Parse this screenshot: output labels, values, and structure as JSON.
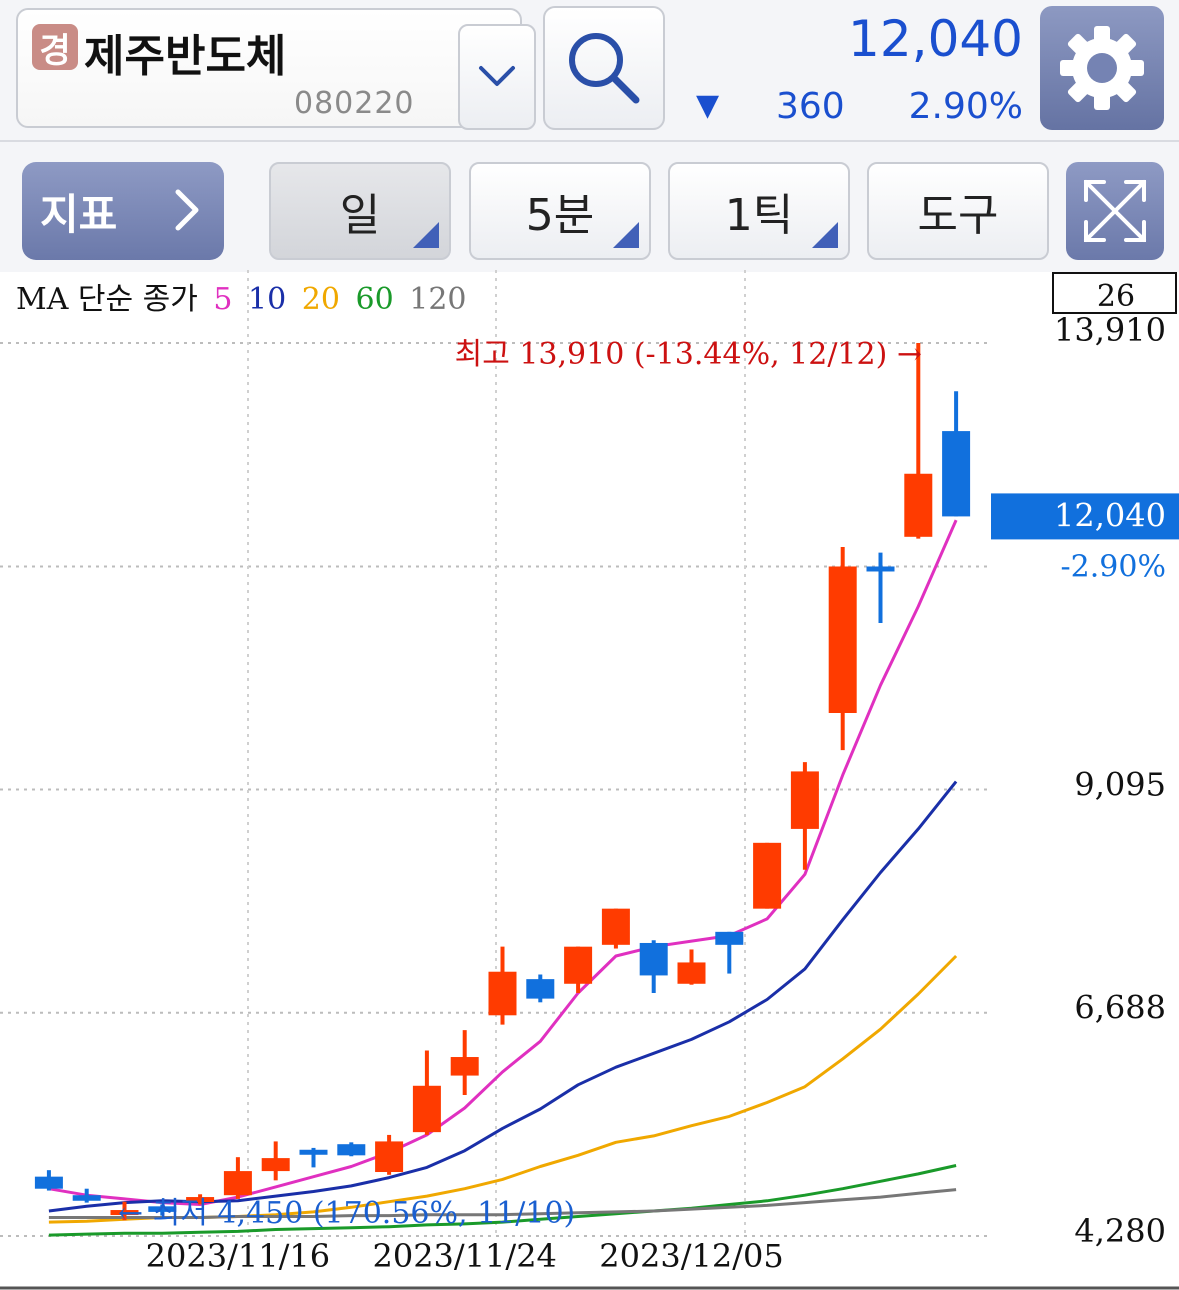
{
  "header": {
    "market_badge": "경",
    "stock_name": "제주반도체",
    "stock_code": "080220",
    "price": "12,040",
    "change_arrow": "▼",
    "change_value": "360",
    "change_pct": "2.90%",
    "price_color": "#1a4fcf"
  },
  "toolbar": {
    "indicator_label": "지표",
    "tabs": [
      {
        "label": "일",
        "active": true
      },
      {
        "label": "5분",
        "active": false
      },
      {
        "label": "1틱",
        "active": false
      }
    ],
    "tool_label": "도구"
  },
  "legend": {
    "title": "MA 단순 종가",
    "periods": [
      {
        "label": "5",
        "color": "#e030c0"
      },
      {
        "label": "10",
        "color": "#1a2fa8"
      },
      {
        "label": "20",
        "color": "#f0a800"
      },
      {
        "label": "60",
        "color": "#1a9a2a"
      },
      {
        "label": "120",
        "color": "#777777"
      }
    ]
  },
  "chart_data": {
    "type": "candlestick",
    "ylim": [
      4280,
      13910
    ],
    "y_ticks": [
      "13,910",
      "9,095",
      "6,688",
      "4,280"
    ],
    "y_tick_values": [
      13910,
      9095,
      6688,
      4280
    ],
    "x_tick_labels": [
      {
        "label": "2023/11/16",
        "index": 5
      },
      {
        "label": "2023/11/24",
        "index": 11
      },
      {
        "label": "2023/12/05",
        "index": 17
      }
    ],
    "count_box": "26",
    "current_price_label": "12,040",
    "current_pct_label": "-2.90%",
    "high_annotation": "최고 13,910 (-13.44%, 12/12) →",
    "low_annotation": "← 최저 4,450 (170.56%, 11/10)",
    "up_color": "#ff3b00",
    "down_color": "#1170dd",
    "candles": [
      {
        "o": 4920,
        "h": 4990,
        "l": 4770,
        "c": 4790
      },
      {
        "o": 4720,
        "h": 4790,
        "l": 4640,
        "c": 4660
      },
      {
        "o": 4560,
        "h": 4650,
        "l": 4450,
        "c": 4560
      },
      {
        "o": 4600,
        "h": 4620,
        "l": 4500,
        "c": 4540
      },
      {
        "o": 4680,
        "h": 4730,
        "l": 4620,
        "c": 4700
      },
      {
        "o": 4720,
        "h": 5130,
        "l": 4680,
        "c": 4980
      },
      {
        "o": 4980,
        "h": 5300,
        "l": 4880,
        "c": 5120
      },
      {
        "o": 5210,
        "h": 5230,
        "l": 5020,
        "c": 5200
      },
      {
        "o": 5270,
        "h": 5290,
        "l": 5140,
        "c": 5150
      },
      {
        "o": 4970,
        "h": 5370,
        "l": 4940,
        "c": 5300
      },
      {
        "o": 5400,
        "h": 6280,
        "l": 5370,
        "c": 5900
      },
      {
        "o": 6010,
        "h": 6500,
        "l": 5800,
        "c": 6210
      },
      {
        "o": 6660,
        "h": 7400,
        "l": 6560,
        "c": 7130
      },
      {
        "o": 7050,
        "h": 7100,
        "l": 6800,
        "c": 6840
      },
      {
        "o": 7000,
        "h": 7290,
        "l": 6900,
        "c": 7400
      },
      {
        "o": 7420,
        "h": 7770,
        "l": 7380,
        "c": 7810
      },
      {
        "o": 7440,
        "h": 7470,
        "l": 6900,
        "c": 7090
      },
      {
        "o": 7000,
        "h": 7370,
        "l": 6990,
        "c": 7230
      },
      {
        "o": 7560,
        "h": 7380,
        "l": 7110,
        "c": 7420
      },
      {
        "o": 7810,
        "h": 8360,
        "l": 8190,
        "c": 8520
      },
      {
        "o": 8670,
        "h": 9390,
        "l": 8230,
        "c": 9290
      },
      {
        "o": 9920,
        "h": 11710,
        "l": 9520,
        "c": 11500
      },
      {
        "o": 11500,
        "h": 11650,
        "l": 10890,
        "c": 11460
      },
      {
        "o": 11820,
        "h": 13910,
        "l": 11800,
        "c": 12500
      },
      {
        "o": 12960,
        "h": 13390,
        "l": 12320,
        "c": 12040
      }
    ],
    "series": [
      {
        "period": "5",
        "values": [
          4790,
          4720,
          4680,
          4640,
          4620,
          4700,
          4810,
          4920,
          5030,
          5180,
          5370,
          5660,
          6050,
          6380,
          6900,
          7300,
          7400,
          7460,
          7520,
          7700,
          8180,
          9250,
          10220,
          11070,
          12000
        ]
      },
      {
        "period": "10",
        "values": [
          4550,
          4600,
          4640,
          4660,
          4650,
          4660,
          4710,
          4760,
          4820,
          4910,
          5020,
          5200,
          5440,
          5650,
          5910,
          6100,
          6250,
          6400,
          6590,
          6830,
          7160,
          7690,
          8200,
          8670,
          9180
        ]
      },
      {
        "period": "20",
        "values": [
          4430,
          4440,
          4460,
          4480,
          4480,
          4490,
          4510,
          4540,
          4590,
          4650,
          4710,
          4790,
          4890,
          5030,
          5150,
          5290,
          5360,
          5470,
          5570,
          5720,
          5890,
          6190,
          6510,
          6890,
          7300
        ]
      },
      {
        "period": "60",
        "values": [
          4290,
          4300,
          4310,
          4310,
          4320,
          4330,
          4350,
          4360,
          4370,
          4380,
          4400,
          4410,
          4430,
          4460,
          4490,
          4520,
          4550,
          4580,
          4620,
          4660,
          4720,
          4790,
          4870,
          4950,
          5040
        ]
      },
      {
        "period": "120",
        "values": [
          4480,
          4480,
          4480,
          4480,
          4480,
          4490,
          4490,
          4490,
          4500,
          4500,
          4510,
          4510,
          4510,
          4520,
          4530,
          4540,
          4550,
          4570,
          4590,
          4610,
          4640,
          4670,
          4700,
          4740,
          4780
        ]
      }
    ]
  }
}
